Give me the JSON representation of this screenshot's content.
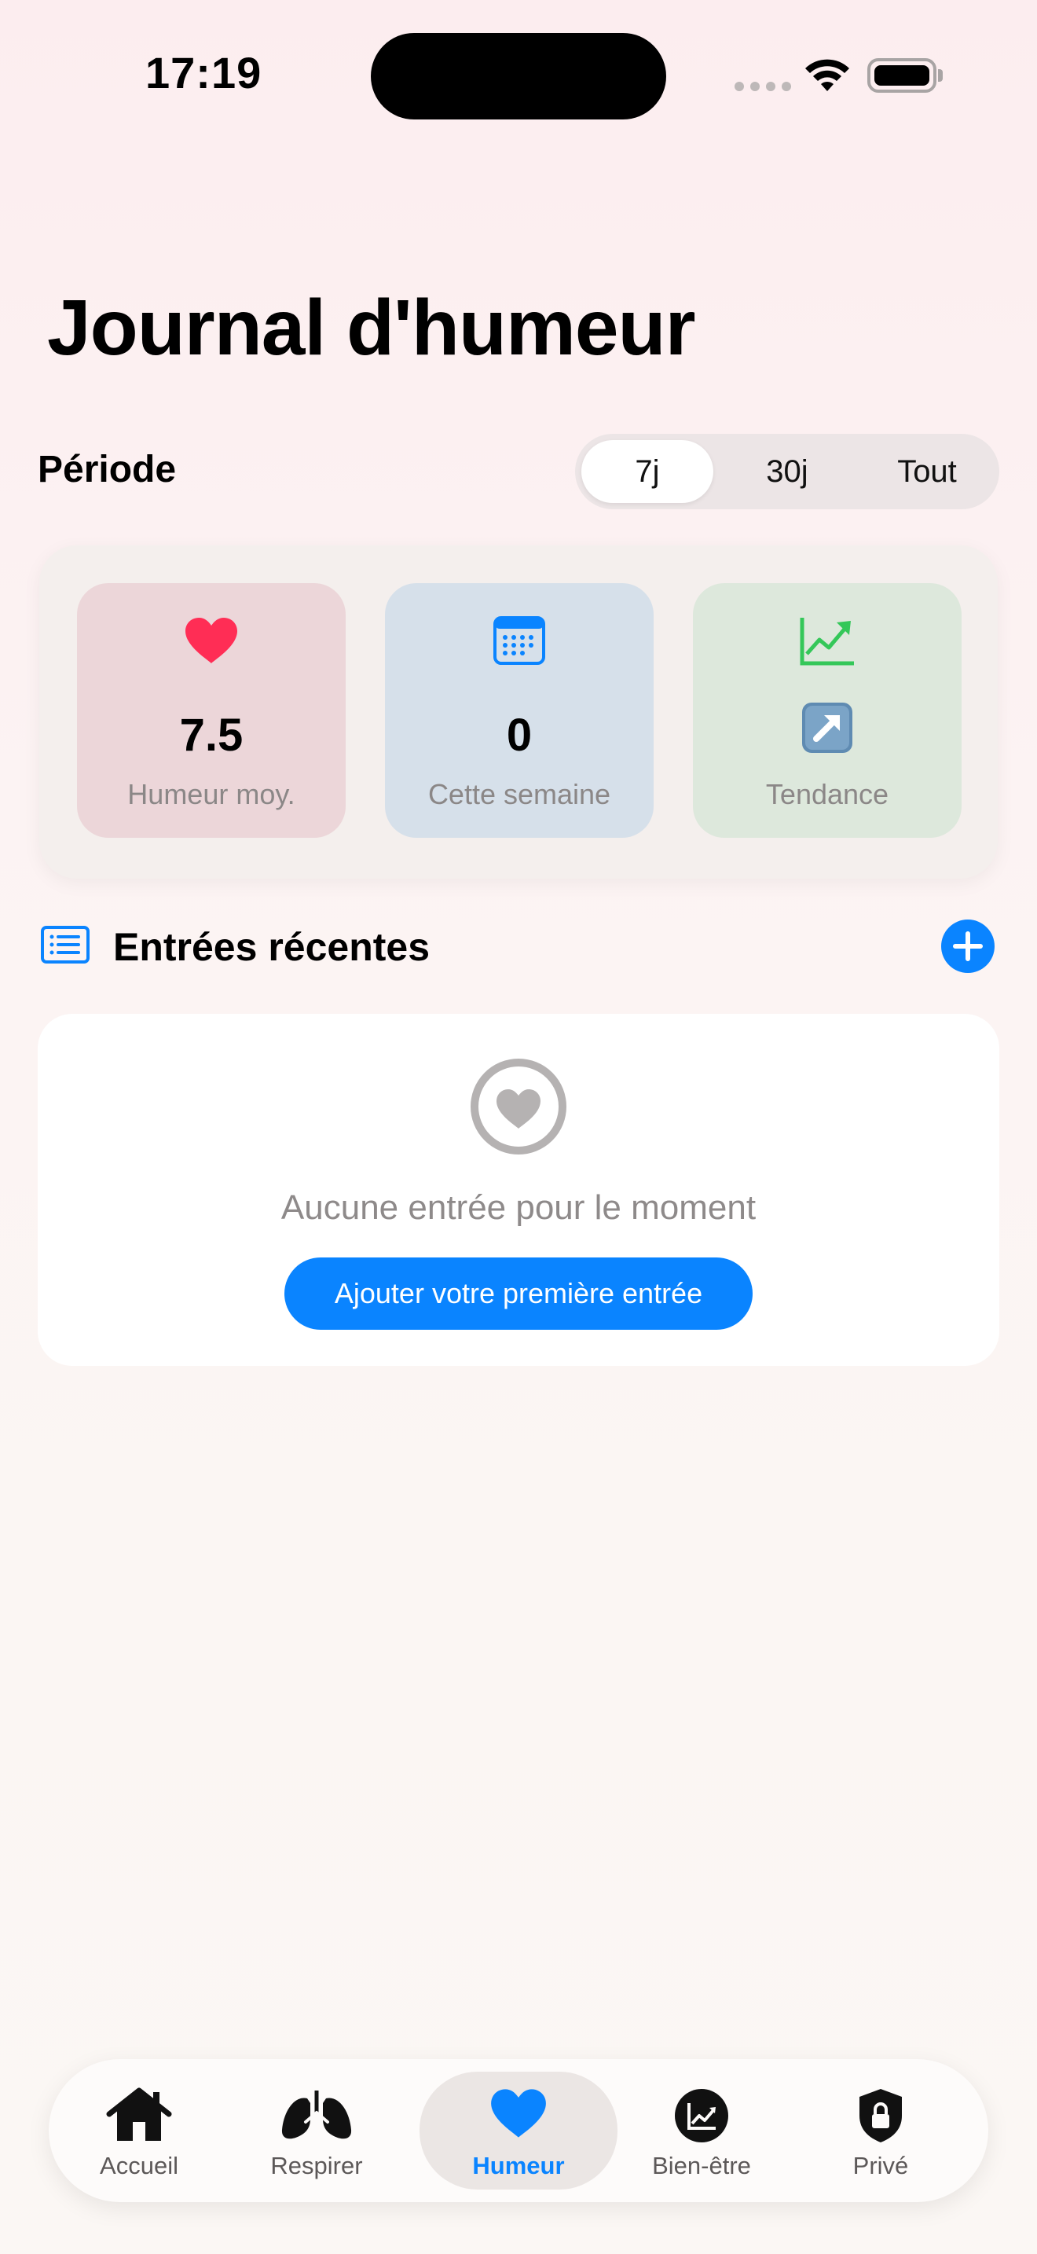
{
  "status_bar": {
    "time": "17:19"
  },
  "page": {
    "title": "Journal d'humeur"
  },
  "period": {
    "label": "Période",
    "options": [
      "7j",
      "30j",
      "Tout"
    ],
    "selected": "7j"
  },
  "stats": [
    {
      "icon": "heart-icon",
      "value": "7.5",
      "label": "Humeur moy.",
      "bg": "#ecd6d9"
    },
    {
      "icon": "calendar-icon",
      "value": "0",
      "label": "Cette semaine",
      "bg": "#d6e0ea"
    },
    {
      "icon": "chart-up-icon",
      "value_icon": "arrow-up-right-emoji-icon",
      "label": "Tendance",
      "bg": "#dde8dc"
    }
  ],
  "recent": {
    "title": "Entrées récentes",
    "empty_text": "Aucune entrée pour le moment",
    "cta_label": "Ajouter votre première entrée"
  },
  "tabbar": {
    "items": [
      {
        "label": "Accueil",
        "icon": "house-icon"
      },
      {
        "label": "Respirer",
        "icon": "lungs-icon"
      },
      {
        "label": "Humeur",
        "icon": "heart-icon",
        "active": true
      },
      {
        "label": "Bien-être",
        "icon": "chart-circle-icon"
      },
      {
        "label": "Privé",
        "icon": "lock-shield-icon"
      }
    ]
  },
  "colors": {
    "accent": "#0a84ff",
    "heart": "#ff2d55",
    "trend": "#34c759"
  }
}
